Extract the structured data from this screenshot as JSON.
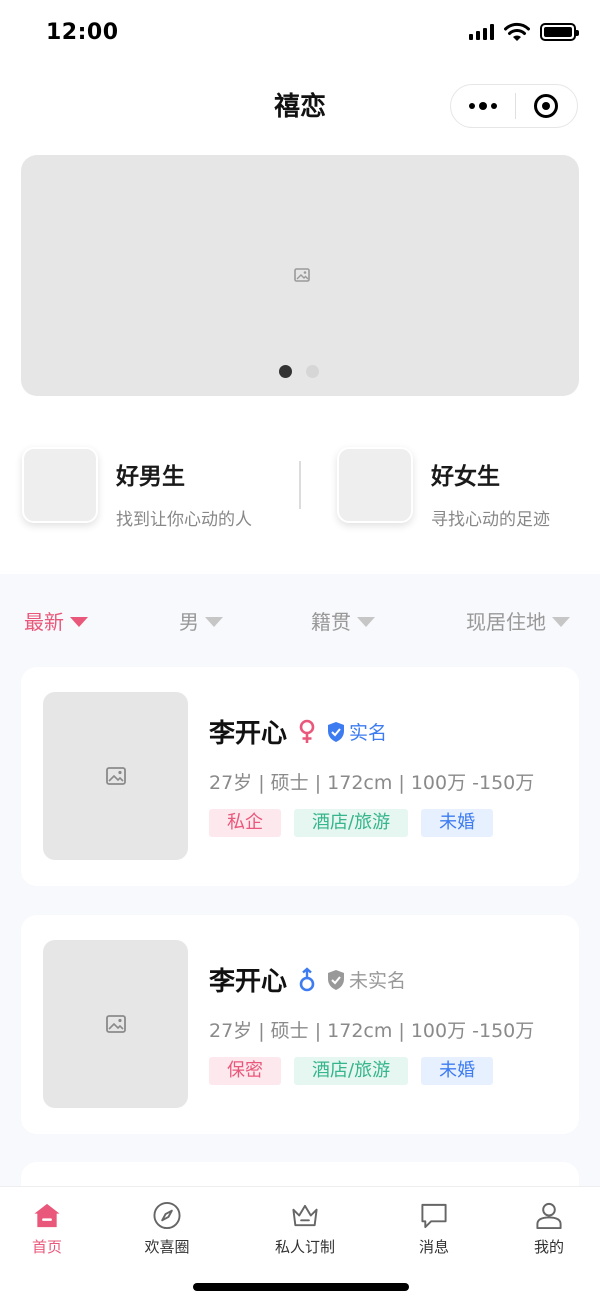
{
  "status_bar": {
    "time": "12:00"
  },
  "nav": {
    "title": "禧恋"
  },
  "banner": {
    "slide_count": 2,
    "active_slide": 1
  },
  "quick": [
    {
      "title": "好男生",
      "subtitle": "找到让你心动的人"
    },
    {
      "title": "好女生",
      "subtitle": "寻找心动的足迹"
    }
  ],
  "filters": [
    {
      "label": "最新",
      "active": true
    },
    {
      "label": "男",
      "active": false
    },
    {
      "label": "籍贯",
      "active": false
    },
    {
      "label": "现居住地",
      "active": false
    }
  ],
  "cards": [
    {
      "name": "李开心",
      "gender": "female",
      "verification": "实名",
      "verified": true,
      "info": "27岁 | 硕士 | 172cm | 100万 -150万",
      "tags": [
        "私企",
        "酒店/旅游",
        "未婚"
      ]
    },
    {
      "name": "李开心",
      "gender": "male",
      "verification": "未实名",
      "verified": false,
      "info": "27岁 | 硕士 | 172cm | 100万 -150万",
      "tags": [
        "保密",
        "酒店/旅游",
        "未婚"
      ]
    }
  ],
  "tabs": [
    {
      "label": "首页",
      "icon": "home-icon",
      "active": true
    },
    {
      "label": "欢喜圈",
      "icon": "compass-icon",
      "active": false
    },
    {
      "label": "私人订制",
      "icon": "crown-icon",
      "active": false
    },
    {
      "label": "消息",
      "icon": "message-icon",
      "active": false
    },
    {
      "label": "我的",
      "icon": "user-icon",
      "active": false
    }
  ],
  "colors": {
    "accent": "#e9587a",
    "verified": "#3d7cf0",
    "unverified": "#999999",
    "tag_pink": "#e9587a",
    "tag_green": "#35b58c",
    "tag_blue": "#3d7cf0"
  }
}
